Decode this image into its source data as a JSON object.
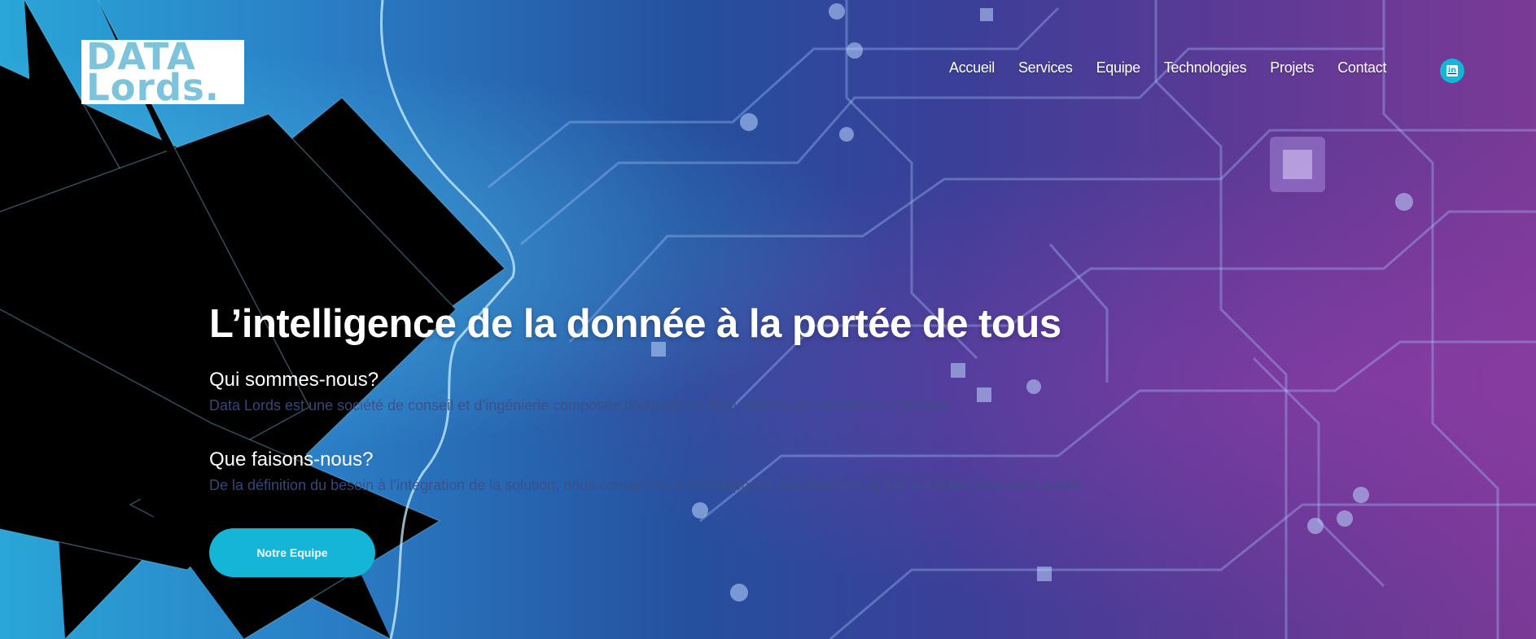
{
  "brand": {
    "logo_line1": "DATA",
    "logo_line2": "Lords."
  },
  "nav": {
    "items": [
      {
        "label": "Accueil"
      },
      {
        "label": "Services"
      },
      {
        "label": "Equipe"
      },
      {
        "label": "Technologies"
      },
      {
        "label": "Projets"
      },
      {
        "label": "Contact"
      }
    ],
    "social_icon": "linkedin-icon"
  },
  "hero": {
    "title": "L’intelligence de la donnée à la portée de tous",
    "who_title": "Qui sommes-nous?",
    "who_text": "Data Lords est une société de conseil et d’ingénierie composée d’experts en data science et intelligence artificielle.",
    "what_title": "Que faisons-nous?",
    "what_text": "De la définition du besoin à l’intégration de la solution, nous concevons et développons des analyses et des solutions Data sur-mesure.",
    "cta_label": "Notre Equipe"
  },
  "colors": {
    "accent": "#14b5d6",
    "logo_text": "#7ec3dc",
    "paragraph": "#3c4f87"
  }
}
